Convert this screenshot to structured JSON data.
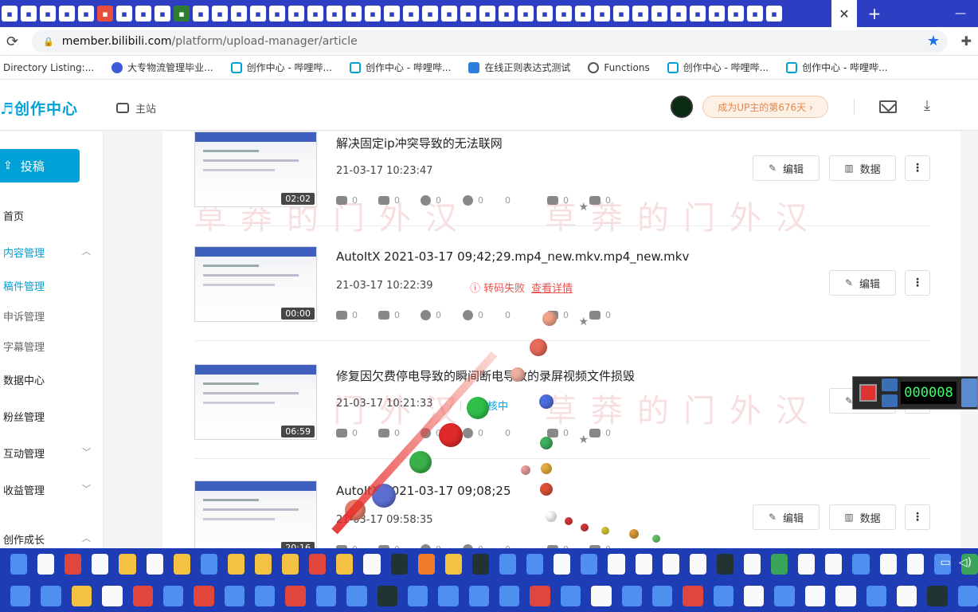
{
  "browser": {
    "url_host": "member.bilibili.com",
    "url_path": "/platform/upload-manager/article",
    "new_tab_label": "+",
    "close_tab_label": "✕"
  },
  "bookmarks": [
    {
      "label": "Directory Listing:...",
      "icon": "none"
    },
    {
      "label": "大专物流管理毕业...",
      "icon": "paw-icon"
    },
    {
      "label": "创作中心 - 哔哩哔...",
      "icon": "bilibili-tv-icon"
    },
    {
      "label": "创作中心 - 哔哩哔...",
      "icon": "bilibili-tv-icon"
    },
    {
      "label": "在线正则表达式测试",
      "icon": "regex-icon"
    },
    {
      "label": "Functions",
      "icon": "autoit-icon"
    },
    {
      "label": "创作中心 - 哔哩哔...",
      "icon": "bilibili-tv-icon"
    },
    {
      "label": "创作中心 - 哔哩哔...",
      "icon": "bilibili-tv-icon"
    }
  ],
  "header": {
    "brand": "创作中心",
    "main_site": "主站",
    "up_badge": "成为UP主的第676天 ›"
  },
  "sidebar": {
    "upload_label": "投稿",
    "items": [
      {
        "label": "首页",
        "style": "normal"
      },
      {
        "label": "内容管理",
        "style": "blue",
        "chevron": "︿"
      },
      {
        "label": "稿件管理",
        "style": "blue-sub"
      },
      {
        "label": "申诉管理",
        "style": "sub"
      },
      {
        "label": "字幕管理",
        "style": "sub"
      },
      {
        "label": "数据中心",
        "style": "normal"
      },
      {
        "label": "粉丝管理",
        "style": "normal"
      },
      {
        "label": "互动管理",
        "style": "normal",
        "chevron": "﹀"
      },
      {
        "label": "收益管理",
        "style": "normal",
        "chevron": "﹀"
      },
      {
        "label": "创作成长",
        "style": "normal",
        "chevron": "︿"
      }
    ]
  },
  "articles": [
    {
      "title": "解决固定ip冲突导致的无法联网",
      "date": "21-03-17 10:23:47",
      "duration": "02:02",
      "status": "",
      "status_detail": "",
      "stats": [
        "0",
        "0",
        "0",
        "0",
        "0",
        "0",
        "0"
      ],
      "edit": "编辑",
      "data": "数据"
    },
    {
      "title": "AutoItX 2021-03-17 09;42;29.mp4_new.mkv.mp4_new.mkv",
      "date": "21-03-17 10:22:39",
      "duration": "00:00",
      "status": "转码失败",
      "status_detail": "查看详情",
      "stats": [
        "0",
        "0",
        "0",
        "0",
        "0",
        "0",
        "0"
      ],
      "edit": "编辑",
      "data": ""
    },
    {
      "title": "修复因欠费停电导致的瞬间断电导致的录屏视频文件损毁",
      "date": "21-03-17 10:21:33",
      "duration": "06:59",
      "status": "审核中",
      "status_detail": "",
      "stats": [
        "0",
        "0",
        "0",
        "0",
        "0",
        "0",
        "0"
      ],
      "edit": "编辑",
      "data": ""
    },
    {
      "title": "AutoItX 2021-03-17 09;08;25",
      "date": "21-03-17 09:58:35",
      "duration": "20:16",
      "status": "",
      "status_detail": "",
      "stats": [
        "0",
        "0",
        "0",
        "0",
        "0",
        "0",
        "0"
      ],
      "edit": "编辑",
      "data": "数据"
    }
  ],
  "watermark": "草莽的门外汉",
  "recorder": {
    "counter": "000008"
  },
  "colors": {
    "accent": "#00a1d6",
    "error": "#e8534e",
    "taskbar": "#1e3db5",
    "tabstrip": "#2d3ec2"
  }
}
